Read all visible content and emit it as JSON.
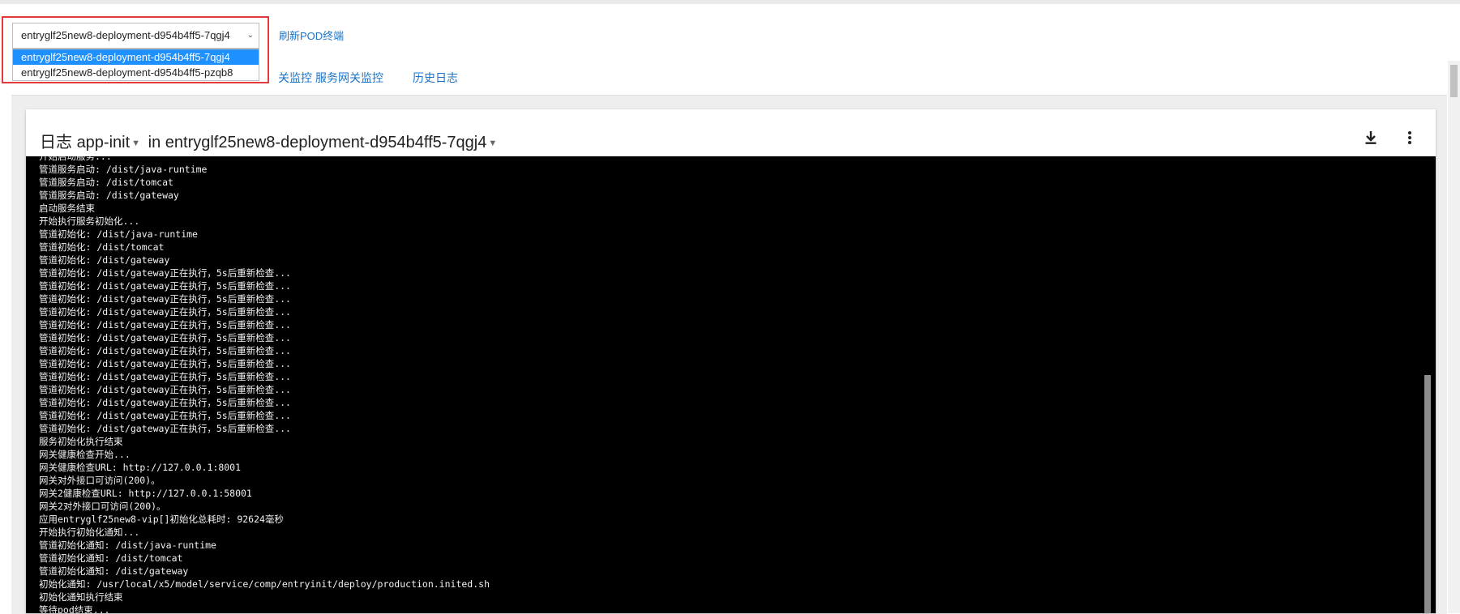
{
  "pod_selector": {
    "selected": "entryglf25new8-deployment-d954b4ff5-7qgj4",
    "options": [
      "entryglf25new8-deployment-d954b4ff5-7qgj4",
      "entryglf25new8-deployment-d954b4ff5-pzqb8"
    ]
  },
  "refresh_label": "刷新POD终端",
  "tabs": {
    "gateway_monitor": "服务网关监控",
    "history_log": "历史日志",
    "partial_monitor": "关监控"
  },
  "log_card": {
    "title_prefix": "日志",
    "container": "app-init",
    "in_label": "in",
    "pod": "entryglf25new8-deployment-d954b4ff5-7qgj4"
  },
  "log_lines": [
    "开始启动服务...",
    "管道服务启动: /dist/java-runtime",
    "管道服务启动: /dist/tomcat",
    "管道服务启动: /dist/gateway",
    "启动服务结束",
    "开始执行服务初始化...",
    "管道初始化: /dist/java-runtime",
    "管道初始化: /dist/tomcat",
    "管道初始化: /dist/gateway",
    "管道初始化: /dist/gateway正在执行，5s后重新检查...",
    "管道初始化: /dist/gateway正在执行，5s后重新检查...",
    "管道初始化: /dist/gateway正在执行，5s后重新检查...",
    "管道初始化: /dist/gateway正在执行，5s后重新检查...",
    "管道初始化: /dist/gateway正在执行，5s后重新检查...",
    "管道初始化: /dist/gateway正在执行，5s后重新检查...",
    "管道初始化: /dist/gateway正在执行，5s后重新检查...",
    "管道初始化: /dist/gateway正在执行，5s后重新检查...",
    "管道初始化: /dist/gateway正在执行，5s后重新检查...",
    "管道初始化: /dist/gateway正在执行，5s后重新检查...",
    "管道初始化: /dist/gateway正在执行，5s后重新检查...",
    "管道初始化: /dist/gateway正在执行，5s后重新检查...",
    "管道初始化: /dist/gateway正在执行，5s后重新检查...",
    "服务初始化执行结束",
    "网关健康检查开始...",
    "网关健康检查URL: http://127.0.0.1:8001",
    "网关对外接口可访问(200)。",
    "网关2健康检查URL: http://127.0.0.1:58001",
    "网关2对外接口可访问(200)。",
    "应用entryglf25new8-vip[]初始化总耗时: 92624毫秒",
    "开始执行初始化通知...",
    "管道初始化通知: /dist/java-runtime",
    "管道初始化通知: /dist/tomcat",
    "管道初始化通知: /dist/gateway",
    "初始化通知: /usr/local/x5/model/service/comp/entryinit/deploy/production.inited.sh",
    "初始化通知执行结束",
    "等待pod结束..."
  ],
  "icons": {
    "download": "download-icon",
    "more": "more-vert-icon",
    "chevron": "chevron-down-icon"
  },
  "colors": {
    "link": "#1a73c7",
    "highlight": "#e23a3a",
    "selected_option": "#1e90ff",
    "terminal_bg": "#000000"
  }
}
